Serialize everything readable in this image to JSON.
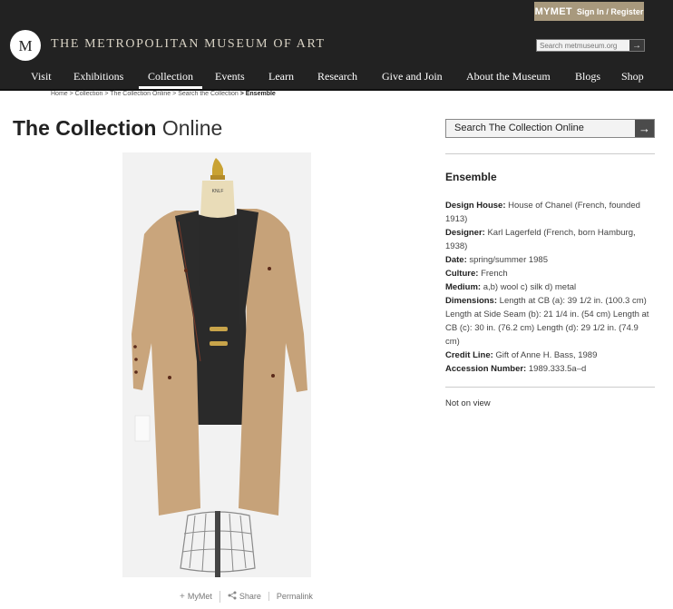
{
  "header": {
    "mymet_label": "MYMET",
    "signin_label": "Sign In / Register",
    "museum_name": "THE METROPOLITAN MUSEUM OF ART",
    "logo_letter": "M",
    "search_placeholder": "Search metmuseum.org",
    "search_go": "→"
  },
  "nav": {
    "items": [
      "Visit",
      "Exhibitions",
      "Collection",
      "Events",
      "Learn",
      "Research",
      "Give and Join",
      "About the Museum",
      "Blogs",
      "Shop"
    ],
    "active": "Collection"
  },
  "breadcrumb": {
    "items": [
      "Home",
      "> Collection",
      "> The Collection Online",
      "> Search the Collection"
    ],
    "current": "> Ensemble"
  },
  "page": {
    "title_bold": "The Collection",
    "title_light": "Online"
  },
  "collection_search": {
    "label": "Search The Collection Online",
    "button": "→"
  },
  "object": {
    "title": "Ensemble",
    "fields": [
      {
        "key": "Design House:",
        "value": "House of Chanel (French, founded 1913)"
      },
      {
        "key": "Designer:",
        "value": "Karl Lagerfeld (French, born Hamburg, 1938)"
      },
      {
        "key": "Date:",
        "value": "spring/summer 1985"
      },
      {
        "key": "Culture:",
        "value": "French"
      },
      {
        "key": "Medium:",
        "value": "a,b) wool c) silk d) metal"
      },
      {
        "key": "Dimensions:",
        "value": "Length at CB (a): 39 1/2 in. (100.3 cm) Length at Side Seam (b): 21 1/4 in. (54 cm) Length at CB (c): 30 in. (76.2 cm) Length (d): 29 1/2 in. (74.9 cm)"
      },
      {
        "key": "Credit Line:",
        "value": "Gift of Anne H. Bass, 1989"
      },
      {
        "key": "Accession Number:",
        "value": "1989.333.5a–d"
      }
    ],
    "view_status": "Not on view"
  },
  "image_actions": {
    "mymet": "MyMet",
    "share": "Share",
    "permalink": "Permalink"
  },
  "mannequin_tag": "KNLF",
  "colors": {
    "header_bg": "#222222",
    "mymet_bg": "#a8997d",
    "coat": "#c9a57c",
    "lining": "#2a2a2a"
  }
}
